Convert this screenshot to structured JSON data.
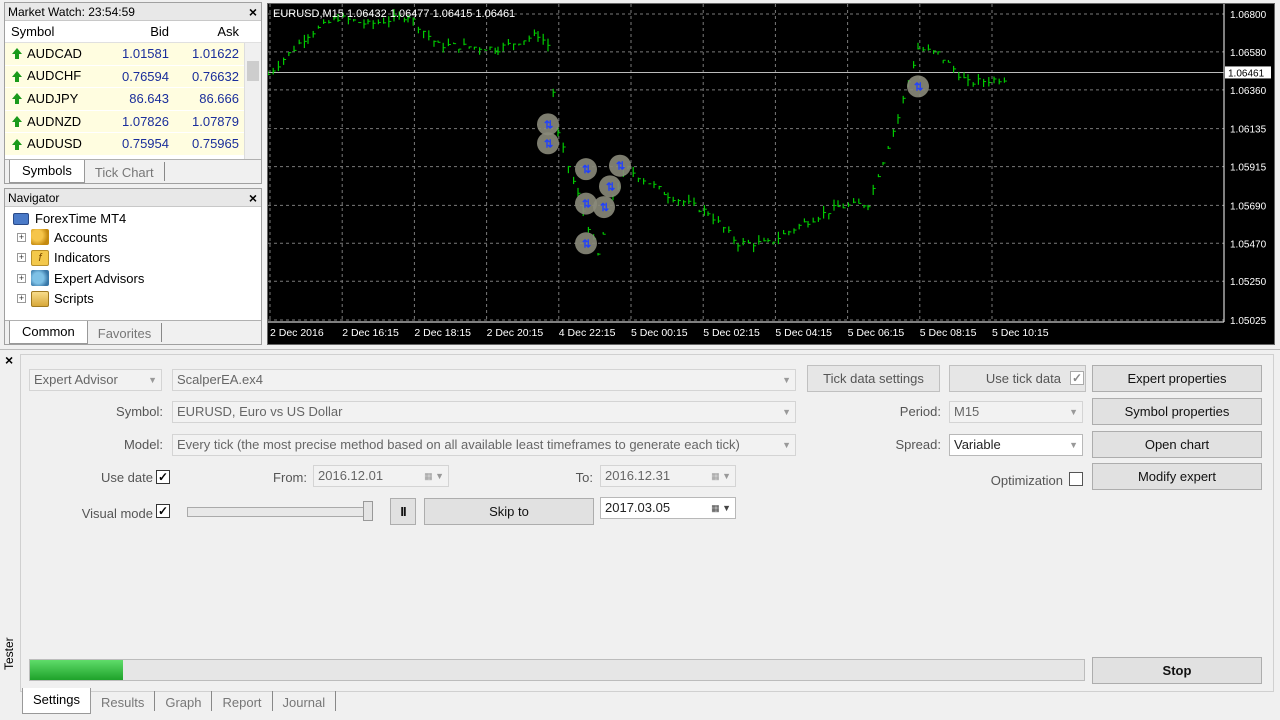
{
  "market_watch": {
    "title": "Market Watch: 23:54:59",
    "col_symbol": "Symbol",
    "col_bid": "Bid",
    "col_ask": "Ask",
    "rows": [
      {
        "symbol": "AUDCAD",
        "bid": "1.01581",
        "ask": "1.01622"
      },
      {
        "symbol": "AUDCHF",
        "bid": "0.76594",
        "ask": "0.76632"
      },
      {
        "symbol": "AUDJPY",
        "bid": "86.643",
        "ask": "86.666"
      },
      {
        "symbol": "AUDNZD",
        "bid": "1.07826",
        "ask": "1.07879"
      },
      {
        "symbol": "AUDUSD",
        "bid": "0.75954",
        "ask": "0.75965"
      }
    ],
    "tabs": [
      "Symbols",
      "Tick Chart"
    ]
  },
  "navigator": {
    "title": "Navigator",
    "root": "ForexTime MT4",
    "items": [
      "Accounts",
      "Indicators",
      "Expert Advisors",
      "Scripts"
    ],
    "tabs": [
      "Common",
      "Favorites"
    ]
  },
  "chart": {
    "header": "EURUSD,M15  1.06432 1.06477 1.06415 1.06461",
    "price_labels": [
      "1.06800",
      "1.06580",
      "1.06360",
      "1.06135",
      "1.05915",
      "1.05690",
      "1.05470",
      "1.05250",
      "1.05025"
    ],
    "current_price": "1.06461",
    "time_labels": [
      "2 Dec 2016",
      "2 Dec 16:15",
      "2 Dec 18:15",
      "2 Dec 20:15",
      "4 Dec 22:15",
      "5 Dec 00:15",
      "5 Dec 02:15",
      "5 Dec 04:15",
      "5 Dec 06:15",
      "5 Dec 08:15",
      "5 Dec 10:15"
    ],
    "colors": {
      "background": "#000000",
      "bars": "#00cc00",
      "grid": "#7a7a7a",
      "text": "#ffffff"
    }
  },
  "tester": {
    "title": "Tester",
    "type": "Expert Advisor",
    "expert": "ScalperEA.ex4",
    "symbol_label": "Symbol:",
    "symbol": "EURUSD, Euro vs US Dollar",
    "model_label": "Model:",
    "model": "Every tick (the most precise method based on all available least timeframes to generate each tick)",
    "use_date_label": "Use date",
    "use_date_checked": true,
    "from_label": "From:",
    "from": "2016.12.01",
    "to_label": "To:",
    "to": "2016.12.31",
    "visual_mode_label": "Visual mode",
    "visual_mode_checked": true,
    "pause_label": "II",
    "skip_to_label": "Skip to",
    "skip_date": "2017.03.05",
    "tick_settings_label": "Tick data settings",
    "use_tick_data_label": "Use tick data",
    "period_label": "Period:",
    "period": "M15",
    "spread_label": "Spread:",
    "spread": "Variable",
    "optimization_label": "Optimization",
    "expert_properties_label": "Expert properties",
    "symbol_properties_label": "Symbol properties",
    "open_chart_label": "Open chart",
    "modify_expert_label": "Modify expert",
    "stop_label": "Stop",
    "progress": 0.088,
    "tabs": [
      "Settings",
      "Results",
      "Graph",
      "Report",
      "Journal"
    ]
  }
}
